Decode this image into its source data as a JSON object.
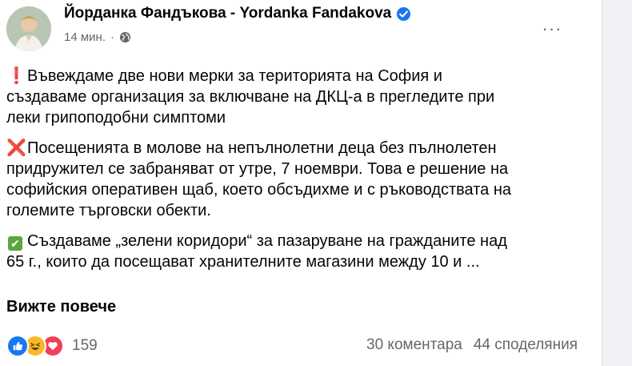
{
  "post": {
    "author": "Йорданка Фандъкова - Yordanka Fandakova",
    "time": "14 мин.",
    "time_separator": "·",
    "more_icon": "···",
    "paragraphs": [
      {
        "icon": "❗",
        "lines": [
          "Въвеждаме две нови мерки за територията на София и",
          "създаваме организация за включване на ДКЦ-а в прегледите при",
          "леки грипоподобни симптоми"
        ]
      },
      {
        "icon": "❌",
        "lines": [
          "Посещенията в молове на непълнолетни деца без пълнолетен",
          "придружител се забраняват от утре, 7 ноември. Това е решение на",
          "софийския оперативен щаб, което обсъдихме и с ръководствата на",
          "големите търговски обекти."
        ]
      },
      {
        "icon": "✔",
        "lines": [
          "Създаваме „зелени коридори“ за пазаруване на гражданите над",
          "65 г., които да посещават хранителните магазини между 10 и ..."
        ]
      }
    ],
    "see_more": "Вижте повече",
    "reactions_count": "159",
    "comments": "30 коментара",
    "shares": "44 споделяния"
  },
  "colors": {
    "text": "#050505",
    "secondary": "#65676b",
    "verified": "#1877f2",
    "like": "#1877f2",
    "haha": "#f7b928",
    "love": "#f33e58"
  }
}
